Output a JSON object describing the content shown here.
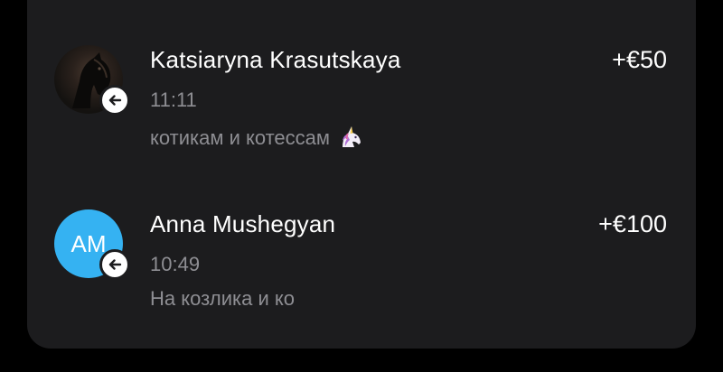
{
  "transactions": [
    {
      "name": "Katsiaryna Krasutskaya",
      "amount": "+€50",
      "time": "11:11",
      "comment": "котикам и котессам",
      "comment_emoji": "unicorn-icon",
      "avatar": "horse-photo",
      "direction_icon": "arrow-left-icon"
    },
    {
      "name": "Anna Mushegyan",
      "amount": "+€100",
      "time": "10:49",
      "comment": "На козлика и ко",
      "avatar_initials": "AM",
      "avatar_color": "#35b2f2",
      "direction_icon": "arrow-left-icon"
    }
  ],
  "colors": {
    "background": "#000000",
    "card": "#1c1c1e",
    "primary_text": "#ffffff",
    "secondary_text": "#8e8e93"
  }
}
